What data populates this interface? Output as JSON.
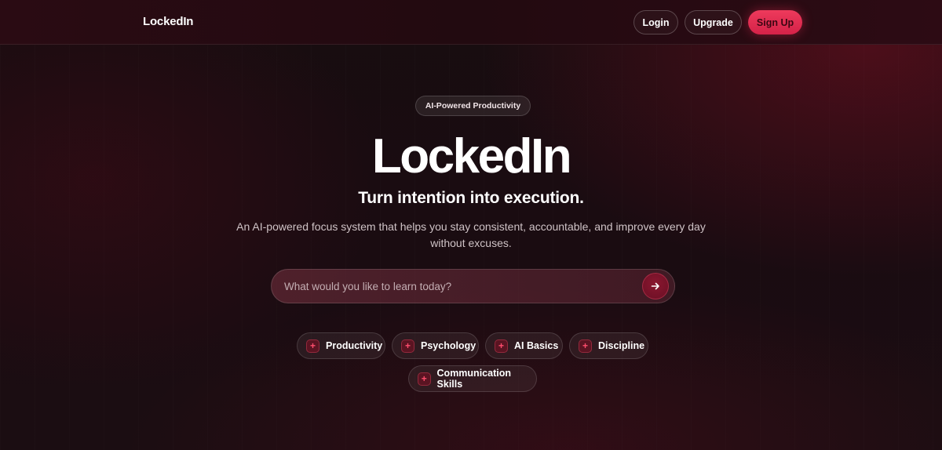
{
  "nav": {
    "brand": "LockedIn",
    "login_label": "Login",
    "upgrade_label": "Upgrade",
    "signup_label": "Sign Up"
  },
  "hero": {
    "badge": "AI-Powered Productivity",
    "title": "LockedIn",
    "subtitle": "Turn intention into execution.",
    "description": "An AI-powered focus system that helps you stay consistent, accountable, and improve every day without excuses."
  },
  "search": {
    "placeholder": "What would you like to learn today?",
    "value": "",
    "submit_icon": "arrow-right-icon"
  },
  "topics": [
    {
      "label": "Productivity",
      "icon": "plus-icon"
    },
    {
      "label": "Psychology",
      "icon": "plus-icon"
    },
    {
      "label": "AI Basics",
      "icon": "plus-icon"
    },
    {
      "label": "Discipline",
      "icon": "plus-icon"
    },
    {
      "label": "Communication Skills",
      "icon": "plus-icon"
    }
  ],
  "colors": {
    "accent": "#e8284f",
    "background": "#1a0c11",
    "chip_icon": "#ff4d6d"
  }
}
